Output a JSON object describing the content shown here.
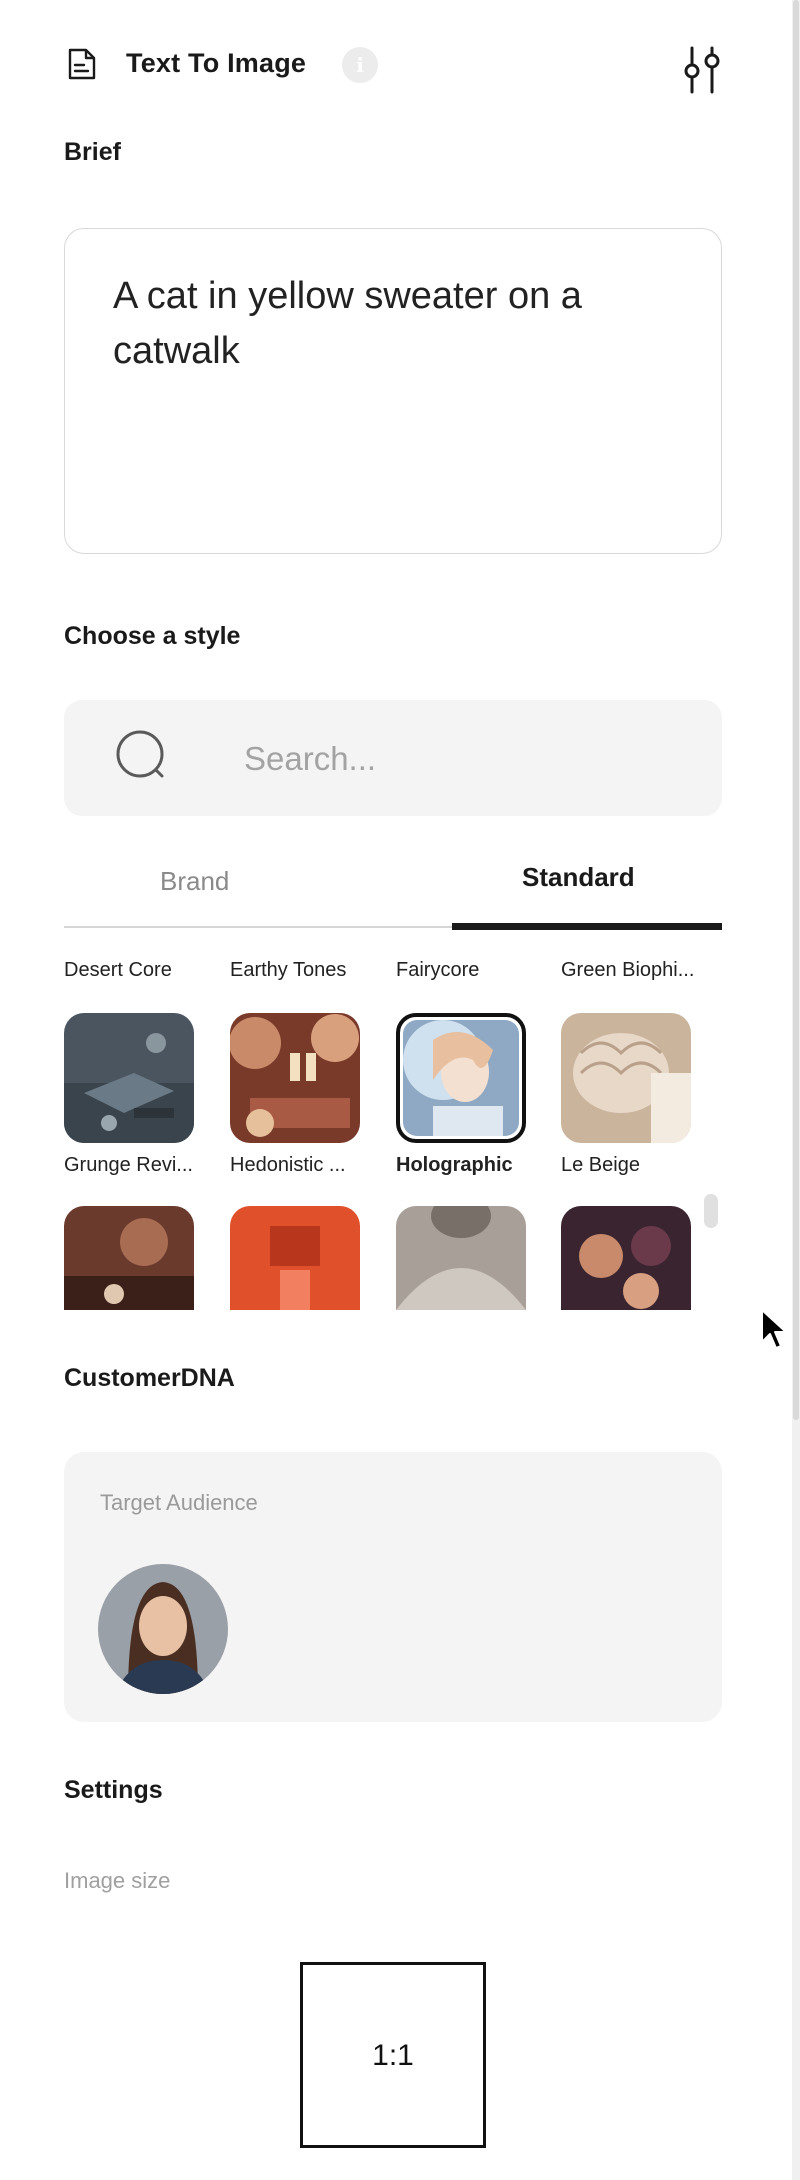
{
  "header": {
    "title": "Text To Image",
    "info_glyph": "i",
    "icons": [
      "document-icon",
      "info-icon",
      "sliders-icon"
    ]
  },
  "brief": {
    "label": "Brief",
    "value": "A cat in yellow sweater on a catwalk"
  },
  "style": {
    "label": "Choose a style",
    "search_placeholder": "Search...",
    "tabs": [
      {
        "label": "Brand",
        "active": false
      },
      {
        "label": "Standard",
        "active": true
      }
    ],
    "row_labels_top": [
      "Desert Core",
      "Earthy Tones",
      "Fairycore",
      "Green Biophi..."
    ],
    "items": [
      {
        "name": "Grunge Revi...",
        "selected": false,
        "colors": [
          "#4a5560",
          "#2e3840",
          "#6a7680"
        ]
      },
      {
        "name": "Hedonistic ...",
        "selected": false,
        "colors": [
          "#c98a6a",
          "#7a3a2a",
          "#e6c09a"
        ]
      },
      {
        "name": "Holographic",
        "selected": true,
        "colors": [
          "#cfe1ee",
          "#8fa9c4",
          "#f4e0d0"
        ]
      },
      {
        "name": "Le Beige",
        "selected": false,
        "colors": [
          "#e8d8c8",
          "#cbb49c",
          "#f4ebe0"
        ]
      }
    ],
    "next_row": [
      {
        "colors": [
          "#6a3a2c",
          "#a86c52",
          "#3a2018"
        ]
      },
      {
        "colors": [
          "#e0502a",
          "#b8361c",
          "#f28060"
        ]
      },
      {
        "colors": [
          "#a8a098",
          "#787068",
          "#cfc8c0"
        ]
      },
      {
        "colors": [
          "#6a3a4a",
          "#c88a6a",
          "#3a2430"
        ]
      }
    ]
  },
  "customer_dna": {
    "label": "CustomerDNA",
    "target_audience_label": "Target Audience"
  },
  "settings": {
    "label": "Settings",
    "image_size_label": "Image size",
    "ratio": "1:1"
  },
  "colors": {
    "accent": "#1a1a1a",
    "muted_text": "#9a9a9a",
    "panel_bg": "#f4f4f4"
  }
}
